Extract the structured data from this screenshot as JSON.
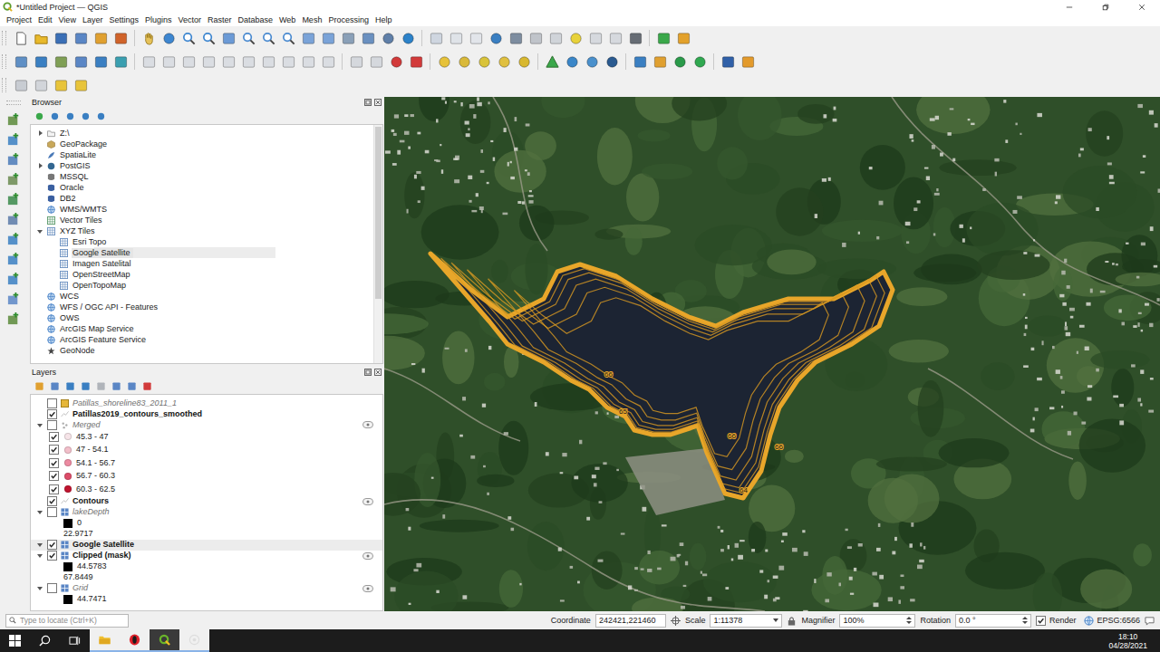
{
  "window": {
    "title": "*Untitled Project — QGIS"
  },
  "menu": [
    "Project",
    "Edit",
    "View",
    "Layer",
    "Settings",
    "Plugins",
    "Vector",
    "Raster",
    "Database",
    "Web",
    "Mesh",
    "Processing",
    "Help"
  ],
  "browser": {
    "title": "Browser",
    "items": [
      {
        "label": "Z:\\",
        "depth": 0,
        "expandable": true,
        "expanded": false,
        "selected": false,
        "kind": "drive"
      },
      {
        "label": "GeoPackage",
        "depth": 0,
        "expandable": false,
        "expanded": false,
        "selected": false,
        "kind": "geopackage"
      },
      {
        "label": "SpatiaLite",
        "depth": 0,
        "expandable": false,
        "expanded": false,
        "selected": false,
        "kind": "spatialite"
      },
      {
        "label": "PostGIS",
        "depth": 0,
        "expandable": true,
        "expanded": false,
        "selected": false,
        "kind": "postgis"
      },
      {
        "label": "MSSQL",
        "depth": 0,
        "expandable": false,
        "expanded": false,
        "selected": false,
        "kind": "mssql"
      },
      {
        "label": "Oracle",
        "depth": 0,
        "expandable": false,
        "expanded": false,
        "selected": false,
        "kind": "oracle"
      },
      {
        "label": "DB2",
        "depth": 0,
        "expandable": false,
        "expanded": false,
        "selected": false,
        "kind": "db2"
      },
      {
        "label": "WMS/WMTS",
        "depth": 0,
        "expandable": false,
        "expanded": false,
        "selected": false,
        "kind": "wms"
      },
      {
        "label": "Vector Tiles",
        "depth": 0,
        "expandable": false,
        "expanded": false,
        "selected": false,
        "kind": "vectortiles"
      },
      {
        "label": "XYZ Tiles",
        "depth": 0,
        "expandable": true,
        "expanded": true,
        "selected": false,
        "kind": "xyz"
      },
      {
        "label": "Esri Topo",
        "depth": 1,
        "expandable": false,
        "expanded": false,
        "selected": false,
        "kind": "tile"
      },
      {
        "label": "Google Satellite",
        "depth": 1,
        "expandable": false,
        "expanded": false,
        "selected": true,
        "kind": "tile"
      },
      {
        "label": "Imagen Satelital",
        "depth": 1,
        "expandable": false,
        "expanded": false,
        "selected": false,
        "kind": "tile"
      },
      {
        "label": "OpenStreetMap",
        "depth": 1,
        "expandable": false,
        "expanded": false,
        "selected": false,
        "kind": "tile"
      },
      {
        "label": "OpenTopoMap",
        "depth": 1,
        "expandable": false,
        "expanded": false,
        "selected": false,
        "kind": "tile"
      },
      {
        "label": "WCS",
        "depth": 0,
        "expandable": false,
        "expanded": false,
        "selected": false,
        "kind": "wms"
      },
      {
        "label": "WFS / OGC API - Features",
        "depth": 0,
        "expandable": false,
        "expanded": false,
        "selected": false,
        "kind": "wfs"
      },
      {
        "label": "OWS",
        "depth": 0,
        "expandable": false,
        "expanded": false,
        "selected": false,
        "kind": "ows"
      },
      {
        "label": "ArcGIS Map Service",
        "depth": 0,
        "expandable": false,
        "expanded": false,
        "selected": false,
        "kind": "arcgis"
      },
      {
        "label": "ArcGIS Feature Service",
        "depth": 0,
        "expandable": false,
        "expanded": false,
        "selected": false,
        "kind": "arcgis"
      },
      {
        "label": "GeoNode",
        "depth": 0,
        "expandable": false,
        "expanded": false,
        "selected": false,
        "kind": "geonode"
      }
    ]
  },
  "layers": {
    "title": "Layers",
    "items": [
      {
        "kind": "layer",
        "label": "Patillas_shoreline83_2011_1",
        "depth": 0,
        "layer_type": "polygon",
        "checked": false,
        "expandable": false,
        "expanded": false,
        "selected": false,
        "indicator": false
      },
      {
        "kind": "layer",
        "label": "Patillas2019_contours_smoothed",
        "depth": 0,
        "layer_type": "line",
        "checked": true,
        "expandable": false,
        "expanded": false,
        "selected": false,
        "indicator": false
      },
      {
        "kind": "layer",
        "label": "Merged",
        "depth": 0,
        "layer_type": "point",
        "checked": false,
        "expandable": true,
        "expanded": true,
        "selected": false,
        "indicator": true
      },
      {
        "kind": "class",
        "label": "45.3 - 47",
        "depth": 1,
        "checked": true,
        "selected": false,
        "color": "#f6e4e8"
      },
      {
        "kind": "class",
        "label": "47 - 54.1",
        "depth": 1,
        "checked": true,
        "selected": false,
        "color": "#f2bfca"
      },
      {
        "kind": "class",
        "label": "54.1 - 56.7",
        "depth": 1,
        "checked": true,
        "selected": false,
        "color": "#ec8aa1"
      },
      {
        "kind": "class",
        "label": "56.7 - 60.3",
        "depth": 1,
        "checked": true,
        "selected": false,
        "color": "#dc4c68"
      },
      {
        "kind": "class",
        "label": "60.3 - 62.5",
        "depth": 1,
        "checked": true,
        "selected": false,
        "color": "#c0142f"
      },
      {
        "kind": "layer",
        "label": "Contours",
        "depth": 0,
        "layer_type": "line",
        "checked": true,
        "expandable": false,
        "expanded": false,
        "selected": false,
        "indicator": true
      },
      {
        "kind": "layer",
        "label": "lakeDepth",
        "depth": 0,
        "layer_type": "raster",
        "checked": false,
        "expandable": true,
        "expanded": true,
        "selected": false,
        "indicator": false
      },
      {
        "kind": "swatch",
        "label": "0",
        "depth": 1,
        "selected": false
      },
      {
        "kind": "value",
        "label": "22.9717",
        "depth": 1,
        "selected": false
      },
      {
        "kind": "layer",
        "label": "Google Satellite",
        "depth": 0,
        "layer_type": "raster",
        "checked": true,
        "expandable": true,
        "expanded": true,
        "selected": true,
        "indicator": false
      },
      {
        "kind": "layer",
        "label": "Clipped (mask)",
        "depth": 0,
        "layer_type": "raster",
        "checked": true,
        "expandable": true,
        "expanded": true,
        "selected": false,
        "indicator": true
      },
      {
        "kind": "swatch",
        "label": "44.5783",
        "depth": 1,
        "selected": false
      },
      {
        "kind": "value",
        "label": "67.8449",
        "depth": 1,
        "selected": false
      },
      {
        "kind": "layer",
        "label": "Grid",
        "depth": 0,
        "layer_type": "raster",
        "checked": false,
        "expandable": true,
        "expanded": true,
        "selected": false,
        "indicator": true
      },
      {
        "kind": "swatch",
        "label": "44.7471",
        "depth": 1,
        "selected": false
      }
    ]
  },
  "map": {
    "contour_labels": [
      "66",
      "65",
      "66",
      "66",
      "64"
    ]
  },
  "status_bar": {
    "locator_placeholder": "Type to locate (Ctrl+K)",
    "coordinate_label": "Coordinate",
    "coordinate": "242421,221460",
    "scale_label": "Scale",
    "scale": "1:11378",
    "magnifier_label": "Magnifier",
    "magnifier": "100%",
    "rotation_label": "Rotation",
    "rotation": "0.0 °",
    "render_label": "Render",
    "render_checked": true,
    "crs": "EPSG:6566"
  },
  "taskbar": {
    "time": "18:10",
    "date": "04/28/2021"
  }
}
